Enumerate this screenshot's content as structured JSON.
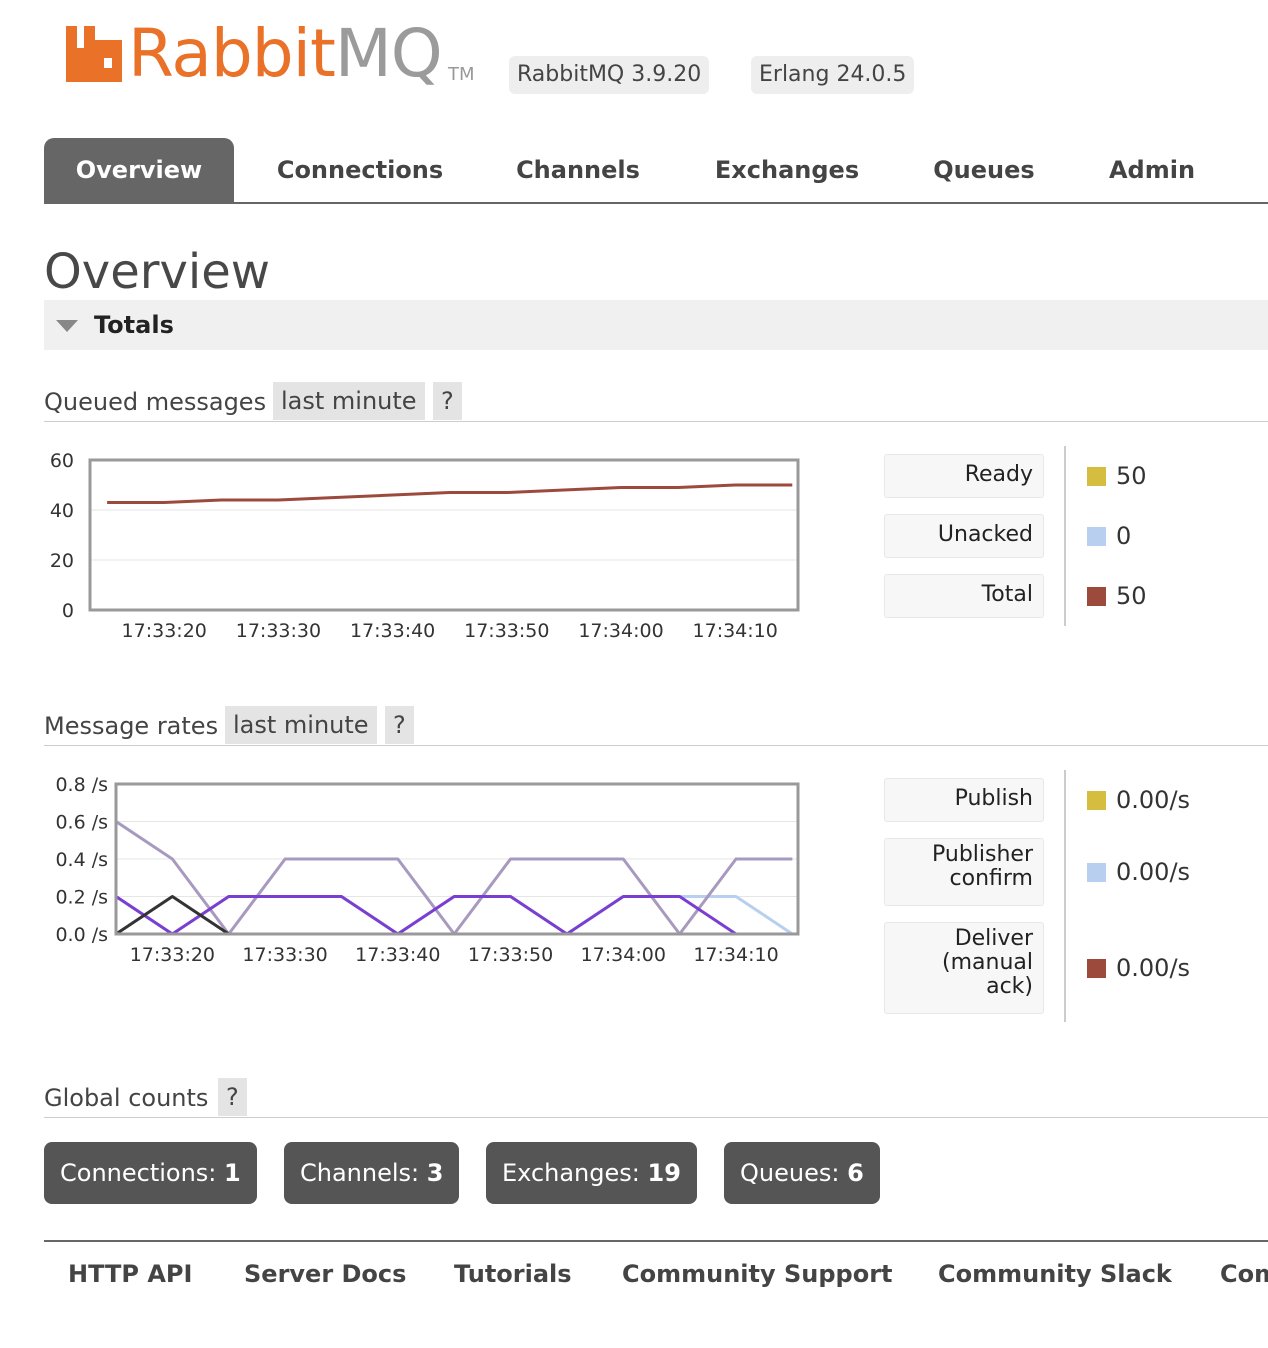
{
  "header": {
    "logo_rabbit": "Rabbit",
    "logo_mq": "MQ",
    "logo_tm": "TM",
    "version_badge": "RabbitMQ 3.9.20",
    "erlang_badge": "Erlang 24.0.5",
    "brand_color": "#ea7128"
  },
  "nav": {
    "tabs": [
      {
        "label": "Overview",
        "active": true
      },
      {
        "label": "Connections",
        "active": false
      },
      {
        "label": "Channels",
        "active": false
      },
      {
        "label": "Exchanges",
        "active": false
      },
      {
        "label": "Queues",
        "active": false
      },
      {
        "label": "Admin",
        "active": false
      }
    ]
  },
  "page": {
    "title": "Overview",
    "section_title": "Totals"
  },
  "queued": {
    "title": "Queued messages",
    "range": "last minute",
    "help": "?",
    "legend": [
      {
        "label": "Ready",
        "value": "50",
        "color": "#d4bd3f"
      },
      {
        "label": "Unacked",
        "value": "0",
        "color": "#b9cff0"
      },
      {
        "label": "Total",
        "value": "50",
        "color": "#9c4a3b"
      }
    ]
  },
  "rates": {
    "title": "Message rates",
    "range": "last minute",
    "help": "?",
    "legend": [
      {
        "label": "Publish",
        "value": "0.00/s",
        "color": "#d4bd3f"
      },
      {
        "label": "Publisher confirm",
        "label_lines": [
          "Publisher",
          "confirm"
        ],
        "value": "0.00/s",
        "color": "#b9cff0"
      },
      {
        "label": "Deliver (manual ack)",
        "label_lines": [
          "Deliver",
          "(manual",
          "ack)"
        ],
        "value": "0.00/s",
        "color": "#9c4a3b"
      }
    ]
  },
  "global": {
    "title": "Global counts",
    "help": "?",
    "counts": [
      {
        "label": "Connections:",
        "value": "1"
      },
      {
        "label": "Channels:",
        "value": "3"
      },
      {
        "label": "Exchanges:",
        "value": "19"
      },
      {
        "label": "Queues:",
        "value": "6"
      }
    ]
  },
  "footer": {
    "links": [
      "HTTP API",
      "Server Docs",
      "Tutorials",
      "Community Support",
      "Community Slack",
      "Com"
    ]
  },
  "chart_data": [
    {
      "type": "line",
      "title": "Queued messages",
      "ylim": [
        0,
        60
      ],
      "yticks": [
        "60",
        "40",
        "20",
        "0"
      ],
      "xticks": [
        "17:33:20",
        "17:33:30",
        "17:33:40",
        "17:33:50",
        "17:34:00",
        "17:34:10"
      ],
      "x_seconds": [
        15,
        20,
        25,
        30,
        35,
        40,
        45,
        50,
        55,
        60,
        65,
        70,
        75
      ],
      "series": [
        {
          "name": "Ready",
          "color": "#d4bd3f",
          "values": [
            0,
            0,
            0,
            0,
            0,
            0,
            0,
            0,
            0,
            0,
            0,
            0,
            0
          ]
        },
        {
          "name": "Unacked",
          "color": "#b9cff0",
          "values": [
            0,
            0,
            0,
            0,
            0,
            0,
            0,
            0,
            0,
            0,
            0,
            0,
            0
          ]
        },
        {
          "name": "Total",
          "color": "#9c4a3b",
          "values": [
            43,
            43,
            44,
            44,
            45,
            46,
            47,
            47,
            48,
            49,
            49,
            50,
            50
          ]
        }
      ]
    },
    {
      "type": "line",
      "title": "Message rates",
      "ylim": [
        0,
        0.8
      ],
      "yticks": [
        "0.8 /s",
        "0.6 /s",
        "0.4 /s",
        "0.2 /s",
        "0.0 /s"
      ],
      "xticks": [
        "17:33:20",
        "17:33:30",
        "17:33:40",
        "17:33:50",
        "17:34:00",
        "17:34:10"
      ],
      "x_seconds": [
        15,
        20,
        25,
        30,
        35,
        40,
        45,
        50,
        55,
        60,
        65,
        70,
        75
      ],
      "series": [
        {
          "name": "Publish",
          "color": "#d4bd3f",
          "values": [
            0,
            0,
            0,
            0,
            0,
            0,
            0,
            0,
            0,
            0,
            0,
            0,
            0
          ]
        },
        {
          "name": "Publisher confirm",
          "color": "#b9cff0",
          "values": [
            0.2,
            0,
            0.2,
            0.2,
            0.2,
            0,
            0.2,
            0.2,
            0,
            0.2,
            0.2,
            0.2,
            0
          ]
        },
        {
          "name": "Deliver (manual ack)",
          "color": "#9c4a3b",
          "values": [
            0,
            0,
            0,
            0,
            0,
            0,
            0,
            0,
            0,
            0,
            0,
            0,
            0
          ]
        },
        {
          "name": "",
          "color": "#a899bf",
          "values": [
            0.6,
            0.4,
            0,
            0.4,
            0.4,
            0.4,
            0,
            0.4,
            0.4,
            0.4,
            0,
            0.4,
            0.4
          ]
        },
        {
          "name": "",
          "color": "#7a3fd1",
          "values": [
            0.2,
            0,
            0.2,
            0.2,
            0.2,
            0,
            0.2,
            0.2,
            0,
            0.2,
            0.2,
            0,
            0
          ]
        },
        {
          "name": "",
          "color": "#333333",
          "values": [
            0,
            0.2,
            0,
            0,
            0,
            0,
            0,
            0,
            0,
            0,
            0,
            0,
            0
          ]
        }
      ]
    }
  ]
}
